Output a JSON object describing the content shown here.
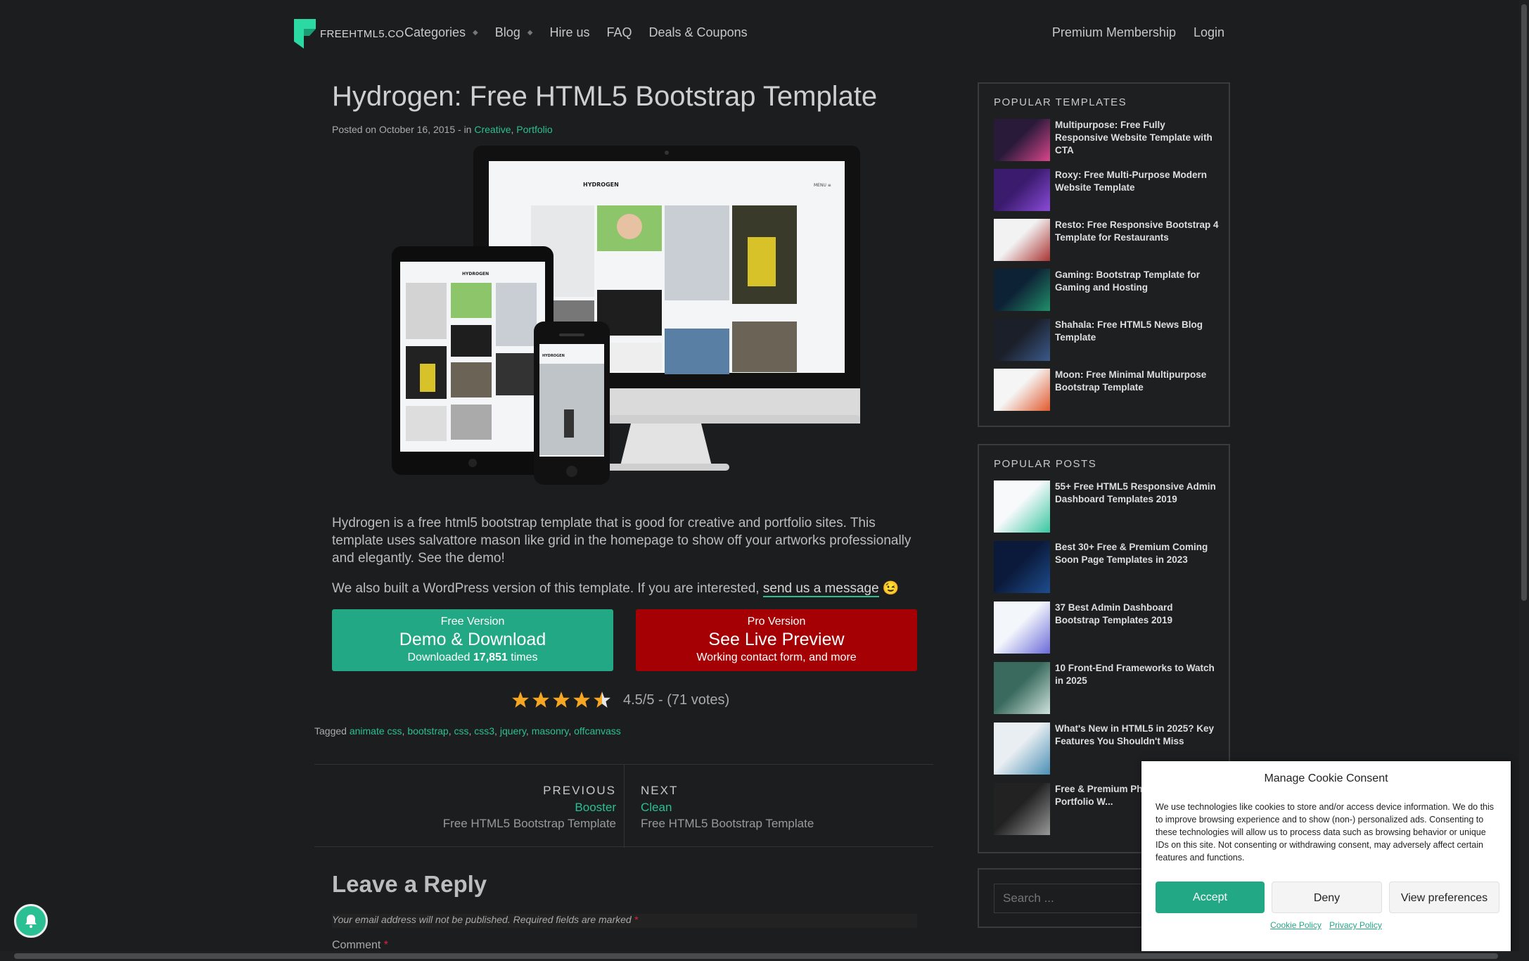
{
  "header": {
    "logo_text": "FREEHTML5.CO",
    "nav": [
      {
        "label": "Categories",
        "has_caret": true
      },
      {
        "label": "Blog",
        "has_caret": true
      },
      {
        "label": "Hire us",
        "has_caret": false
      },
      {
        "label": "FAQ",
        "has_caret": false
      },
      {
        "label": "Deals & Coupons",
        "has_caret": false
      }
    ],
    "nav_right": [
      "Premium Membership",
      "Login"
    ]
  },
  "article": {
    "title": "Hydrogen: Free HTML5 Bootstrap Template",
    "meta_prefix": "Posted on October 16, 2015 - in ",
    "categories": [
      "Creative",
      "Portfolio"
    ],
    "description": "Hydrogen is a free html5 bootstrap template that is good for creative and portfolio sites. This template uses salvattore mason like grid in the homepage to show off your artworks professionally and elegantly. See the demo!",
    "wp_note_prefix": "We also built a WordPress version of this template. If you are interested, ",
    "wp_note_link": "send us a message",
    "wp_emoji": "😉",
    "device_brand": "HYDROGEN",
    "device_menu": "MENU ≡",
    "free_button": {
      "small": "Free Version",
      "big": "Demo & Download",
      "sub_prefix": "Downloaded ",
      "downloads": "17,851",
      "sub_suffix": " times"
    },
    "pro_button": {
      "small": "Pro Version",
      "big": "See Live Preview",
      "sub": "Working contact form, and more"
    },
    "rating": {
      "value": 4.5,
      "max": 5,
      "text": "4.5/5 - (71 votes)"
    },
    "tags_prefix": "Tagged ",
    "tags": [
      "animate css",
      "bootstrap",
      "css",
      "css3",
      "jquery",
      "masonry",
      "offcanvass"
    ],
    "post_nav": {
      "prev_label": "PREVIOUS",
      "prev_name": "Booster",
      "prev_sub": "Free HTML5 Bootstrap Template",
      "next_label": "NEXT",
      "next_name": "Clean",
      "next_sub": "Free HTML5 Bootstrap Template"
    },
    "reply": {
      "title": "Leave a Reply",
      "note": "Your email address will not be published. Required fields are marked ",
      "required_mark": "*",
      "comment_label": "Comment "
    }
  },
  "sidebar": {
    "popular_templates_title": "POPULAR TEMPLATES",
    "popular_templates": [
      "Multipurpose: Free Fully Responsive Website Template with CTA",
      "Roxy: Free Multi-Purpose Modern Website Template",
      "Resto: Free Responsive Bootstrap 4 Template for Restaurants",
      "Gaming: Bootstrap Template for Gaming and Hosting",
      "Shahala: Free HTML5 News Blog Template",
      "Moon: Free Minimal Multipurpose Bootstrap Template"
    ],
    "popular_posts_title": "POPULAR POSTS",
    "popular_posts": [
      "55+ Free HTML5 Responsive Admin Dashboard Templates 2019",
      "Best 30+ Free & Premium Coming Soon Page Templates in 2023",
      "37 Best Admin Dashboard Bootstrap Templates 2019",
      "10 Front-End Frameworks to Watch in 2025",
      "What's New in HTML5 in 2025? Key Features You Shouldn't Miss",
      "Free & Premium Ph... Creative Portfolio W..."
    ],
    "search_placeholder": "Search ..."
  },
  "cookie": {
    "title": "Manage Cookie Consent",
    "text": "We use technologies like cookies to store and/or access device information. We do this to improve browsing experience and to show (non-) personalized ads. Consenting to these technologies will allow us to process data such as browsing behavior or unique IDs on this site. Not consenting or withdrawing consent, may adversely affect certain features and functions.",
    "accept": "Accept",
    "deny": "Deny",
    "preferences": "View preferences",
    "cookie_policy": "Cookie Policy",
    "privacy_policy": "Privacy Policy"
  },
  "colors": {
    "accent": "#2bbf94",
    "free_button": "#22a884",
    "pro_button": "#a50003",
    "background": "#1c1d1f",
    "star": "#f5a623"
  }
}
